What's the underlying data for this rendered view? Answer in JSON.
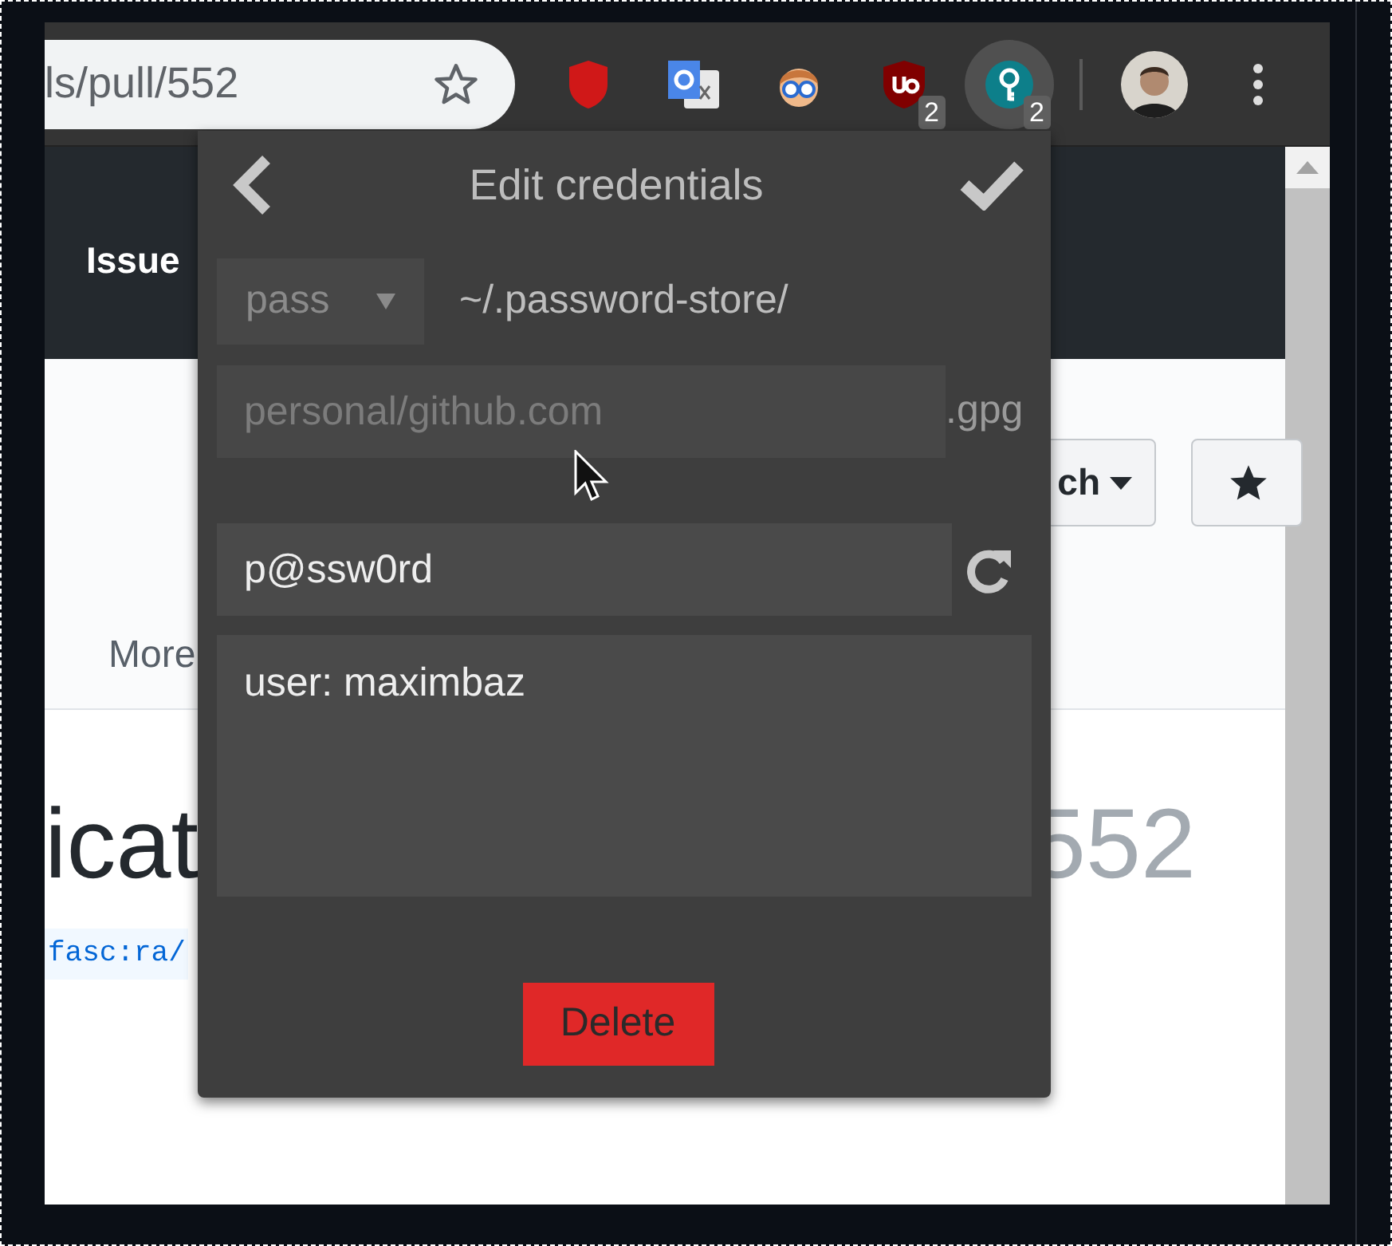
{
  "toolbar": {
    "address": "ls/pull/552",
    "extensions": [
      {
        "kind": "shield",
        "selected": false
      },
      {
        "kind": "translate",
        "selected": false
      },
      {
        "kind": "figure",
        "selected": false
      },
      {
        "kind": "ublock",
        "selected": false,
        "badge": "2"
      },
      {
        "kind": "key",
        "selected": true,
        "badge": "2"
      }
    ]
  },
  "page": {
    "nav_label": "Issue",
    "branch_button_label": "ch",
    "tab_label": "More",
    "title": "icat",
    "number": "552",
    "branch": "fasc:ra/"
  },
  "popup": {
    "title": "Edit credentials",
    "store": "pass",
    "store_path": "~/.password-store/",
    "filename_placeholder": "personal/github.com",
    "extension": ".gpg",
    "password": "p@ssw0rd",
    "notes": "user: maximbaz",
    "delete_label": "Delete"
  }
}
